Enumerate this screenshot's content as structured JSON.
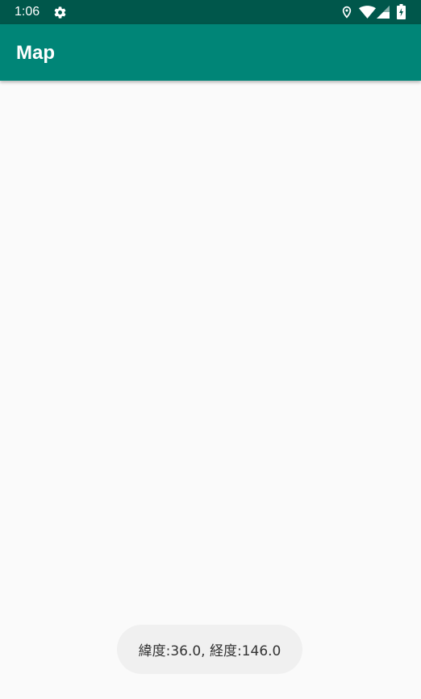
{
  "status_bar": {
    "time": "1:06",
    "icons": [
      "gear-icon",
      "location-pin-icon",
      "wifi-icon",
      "cell-signal-icon",
      "battery-charging-icon"
    ]
  },
  "app_bar": {
    "title": "Map"
  },
  "toast": {
    "message": "緯度:36.0, 経度:146.0"
  },
  "colors": {
    "status_bar": "#00574b",
    "app_bar": "#008577",
    "background": "#fafafa",
    "toast_background": "#f0f0f0"
  }
}
